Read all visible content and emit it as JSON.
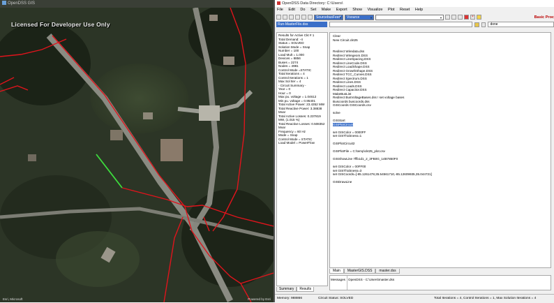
{
  "map": {
    "title": "OpenDSS GIS",
    "license": "Licensed For Developer Use Only",
    "attribution_left": "Esri, Microsoft",
    "attribution_right": "Powered by Esri"
  },
  "app": {
    "title": "OpenDSS Data Directory: C:\\Users\\",
    "menu": [
      "File",
      "Edit",
      "Do",
      "Set",
      "Make",
      "Export",
      "Show",
      "Visualize",
      "Plot",
      "Reset",
      "Help"
    ],
    "toolbar": {
      "circuit_combo": "SourcebusFeed",
      "element_combo": "Vsource",
      "help_label": "Basic Proc"
    },
    "file_selector": "Run-MasterFile.dss",
    "command_box": "done",
    "summary_lines": [
      "Results for Active Ckt # 1",
      "Total Demand: -4",
      "Status = SOLVED",
      "Solution Mode = Snap",
      "Number = 100",
      "Load Mult = 1.000",
      "Devices = 8856",
      "Buses = 2274",
      "Nodes = 4981",
      "Control Mode =STATIC",
      "Total Iterations = 4",
      "Control Iterations = 1",
      "Max Sol Iter = 4",
      "",
      "- Circuit Summary -",
      "",
      "Year = 0",
      "Hour = 0",
      "Max pu. voltage = 1.04612",
      "Min pu. voltage = 0.95401",
      "Total Active Power:   23.4352 MW",
      "Total Reactive Power: 3.38838",
      "Mvar",
      "Total Active Losses:  0.237819",
      "MW, (1.015 %)",
      "Total Reactive Losses: 0.508352",
      "Mvar",
      "Frequency = 60 Hz",
      "Mode = Snap",
      "Control Mode = STATIC",
      "Load Model = PowerFlow"
    ],
    "summary_tabs": [
      "Summary",
      "Results"
    ],
    "editor_lines": [
      "Clear",
      "New Circuit.ckt25",
      "",
      "",
      "Redirect Wiredata.dss",
      "Redirect Wiregeom.DSS",
      "Redirect LineSpacing.DSS",
      "Redirect LineCode.DSS",
      "Redirect LoadShape.DSS",
      "Redirect GrowthShape.DSS",
      "Redirect TCC_Curves.DSS",
      "Redirect Spectrum.DSS",
      "Redirect Lines.DSS",
      "Redirect Loads.DSS",
      "Redirect Capacitor.DSS",
      "MakeBusList",
      "Redirect BusVoltageBases.dss ! set voltage bases",
      "Buscoords buscoords.dss",
      "GISCoords GISCoords.csv",
      "",
      "solve",
      "",
      "GISStart",
      "GISPlotCircuit",
      "",
      "set GISColor = 0000FF",
      "set GISThickness=1",
      "",
      "GISPlotCircuit2",
      "",
      "GISPlotFile = C:\\temp\\ckt25_plot.csv",
      "",
      "GISShowLine 7ffb1d1_2_3FB0G_14B7850F0",
      "",
      "set GISColor = 00FF00",
      "set GISThickness=3",
      "set GISCoords=[-85.1261478,35.54561710,-85.12609935,35.044721]",
      "",
      "GISDrawLine"
    ],
    "editor_highlight_index": 23,
    "editor_tabs": [
      "Main",
      "MasterGIS.DSS",
      "master.dss"
    ],
    "messages_label": "Messages",
    "messages_text": "OpenDSS - C:\\Users\\master.dss",
    "status": {
      "memory": "Memory: 988866",
      "circuit_status": "Circuit Status: SOLVED",
      "iterations": "Total Iterations = 4, Control Iterations = 1, Max Solution Iterations = 4"
    }
  },
  "colors": {
    "feeder_line": "#e0141c",
    "highlight_line": "#3ddc3d",
    "map_bg": "#1f241b",
    "selection": "#3b6fc8"
  }
}
